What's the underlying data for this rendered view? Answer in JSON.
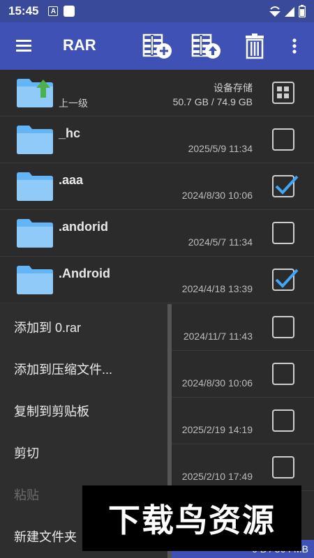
{
  "status_bar": {
    "time": "15:45",
    "badge": "A"
  },
  "app_bar": {
    "title": "RAR"
  },
  "toolbar": {
    "add_archive_icon": "archive-add-icon",
    "extract_icon": "archive-extract-icon",
    "delete_icon": "delete-icon",
    "more_icon": "more-vert-icon"
  },
  "parent_row": {
    "label": "上一级",
    "storage_label": "设备存储",
    "storage_size": "50.7 GB / 74.9 GB"
  },
  "files": [
    {
      "name": "_hc",
      "date": "2025/5/9 11:34",
      "checked": false
    },
    {
      "name": ".aaa",
      "date": "2024/8/30 10:06",
      "checked": true
    },
    {
      "name": ".andorid",
      "date": "2024/5/7 11:34",
      "checked": false
    },
    {
      "name": ".Android",
      "date": "2024/4/18 13:39",
      "checked": true
    },
    {
      "name": "",
      "date": "2024/11/7 11:43",
      "checked": false
    },
    {
      "name": "",
      "date": "2024/8/30 10:06",
      "checked": false
    },
    {
      "name": "",
      "date": "2025/2/19 14:19",
      "checked": false
    },
    {
      "name": "",
      "date": "2025/2/10 17:49",
      "checked": false
    }
  ],
  "menu": {
    "items": [
      {
        "label": "添加到 0.rar",
        "enabled": true
      },
      {
        "label": "添加到压缩文件...",
        "enabled": true
      },
      {
        "label": "复制到剪贴板",
        "enabled": true
      },
      {
        "label": "剪切",
        "enabled": true
      },
      {
        "label": "粘贴",
        "enabled": false
      },
      {
        "label": "新建文件夹",
        "enabled": true
      }
    ]
  },
  "bottom_bar": {
    "text": "0 B / 564 MB"
  },
  "watermark": {
    "text": "下载鸟资源"
  },
  "colors": {
    "primary": "#3f51b5",
    "accent": "#42a5f5",
    "background": "#2b2b2b"
  }
}
